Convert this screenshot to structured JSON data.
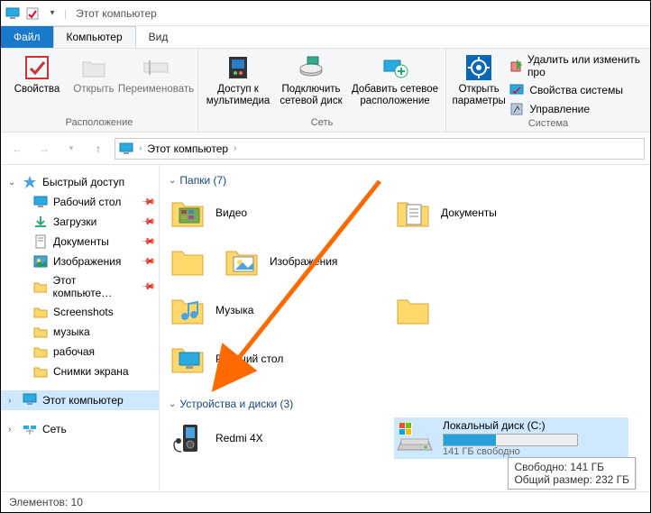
{
  "title": "Этот компьютер",
  "menu": {
    "file": "Файл",
    "computer": "Компьютер",
    "view": "Вид"
  },
  "ribbon": {
    "location": {
      "name": "Расположение",
      "properties": "Свойства",
      "open": "Открыть",
      "rename": "Переименовать"
    },
    "network": {
      "name": "Сеть",
      "media": "Доступ к\nмультимедиа",
      "mapdrive": "Подключить\nсетевой диск",
      "addnet": "Добавить сетевое\nрасположение"
    },
    "system": {
      "name": "Система",
      "settings": "Открыть\nпараметры",
      "remove": "Удалить или изменить про",
      "sysprop": "Свойства системы",
      "manage": "Управление"
    }
  },
  "breadcrumb": "Этот компьютер",
  "sidebar": {
    "quick": "Быстрый доступ",
    "items": [
      {
        "label": "Рабочий стол",
        "pin": true,
        "icon": "desktop"
      },
      {
        "label": "Загрузки",
        "pin": true,
        "icon": "downloads"
      },
      {
        "label": "Документы",
        "pin": true,
        "icon": "documents"
      },
      {
        "label": "Изображения",
        "pin": true,
        "icon": "pictures"
      },
      {
        "label": "Этот компьюте…",
        "pin": true,
        "icon": "folder"
      },
      {
        "label": "Screenshots",
        "pin": false,
        "icon": "folder"
      },
      {
        "label": "музыка",
        "pin": false,
        "icon": "folder"
      },
      {
        "label": "рабочая",
        "pin": false,
        "icon": "folder"
      },
      {
        "label": "Снимки экрана",
        "pin": false,
        "icon": "folder"
      }
    ],
    "thispc": "Этот компьютер",
    "network": "Сеть"
  },
  "sections": {
    "folders": {
      "title": "Папки (7)",
      "items": [
        "Видео",
        "Документы",
        "Изображения",
        "Музыка",
        "Рабочий стол"
      ]
    },
    "devices": {
      "title": "Устройства и диски (3)",
      "phone": "Redmi 4X",
      "drive": {
        "name": "Локальный диск (C:)",
        "sub": "141 ГБ свободно",
        "pct": 39,
        "tip1": "Свободно: 141 ГБ",
        "tip2": "Общий размер: 232 ГБ"
      }
    }
  },
  "status": "Элементов: 10"
}
